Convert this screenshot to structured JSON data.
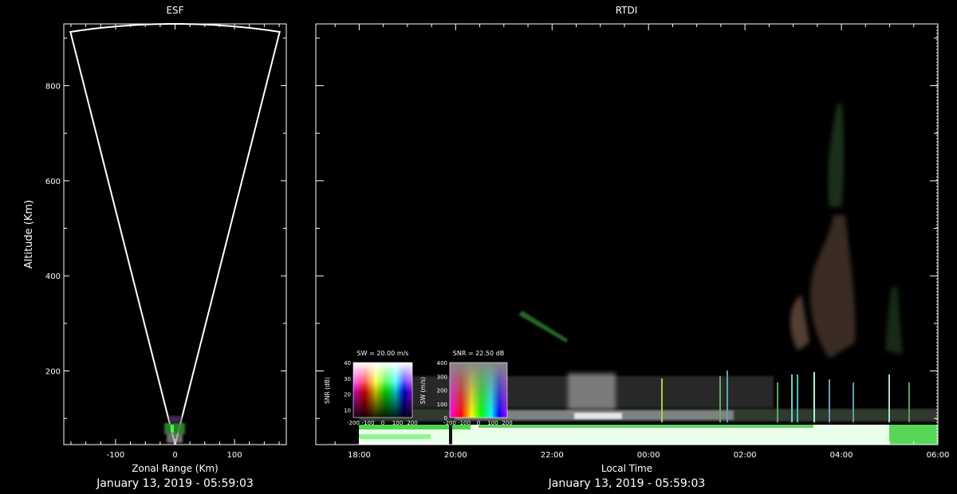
{
  "chart_data": [
    {
      "type": "scatter",
      "title": "ESF",
      "xlabel": "Zonal Range (Km)",
      "ylabel": "Altitude (Km)",
      "footer": "January 13, 2019 - 05:59:03",
      "xlim": [
        -187,
        187
      ],
      "ylim": [
        45,
        930
      ],
      "xticks": [
        {
          "value": -100,
          "label": "-100"
        },
        {
          "value": 0,
          "label": "0"
        },
        {
          "value": 100,
          "label": "100"
        }
      ],
      "yticks": [
        {
          "value": 200,
          "label": "200"
        },
        {
          "value": 400,
          "label": "400"
        },
        {
          "value": 600,
          "label": "600"
        },
        {
          "value": 800,
          "label": "800"
        }
      ],
      "beam_half_angle_deg": 10.9,
      "beam_max_range_km": 930
    },
    {
      "type": "heatmap",
      "title": "RTDI",
      "xlabel": "Local Time",
      "footer": "January 13, 2019 - 05:59:03",
      "xticks": [
        "18:00",
        "20:00",
        "22:00",
        "00:00",
        "02:00",
        "04:00",
        "06:00"
      ],
      "xlim_hours": [
        17.1,
        30.0
      ],
      "ylim": [
        45,
        930
      ],
      "yticks": [
        200,
        400,
        600,
        800
      ],
      "colorbars": [
        {
          "title": "SW = 20.00 m/s",
          "ylabel": "SNR (dB)",
          "xticks": [
            "-200",
            "-100",
            "0",
            "100",
            "200"
          ],
          "yticks": [
            "10",
            "20",
            "30",
            "40"
          ]
        },
        {
          "title": "SNR = 22.50 dB",
          "ylabel": "SW (m/s)",
          "xticks": [
            "-200",
            "-100",
            "0",
            "100",
            "200"
          ],
          "yticks": [
            "0",
            "100",
            "200",
            "300",
            "400"
          ]
        }
      ]
    }
  ]
}
